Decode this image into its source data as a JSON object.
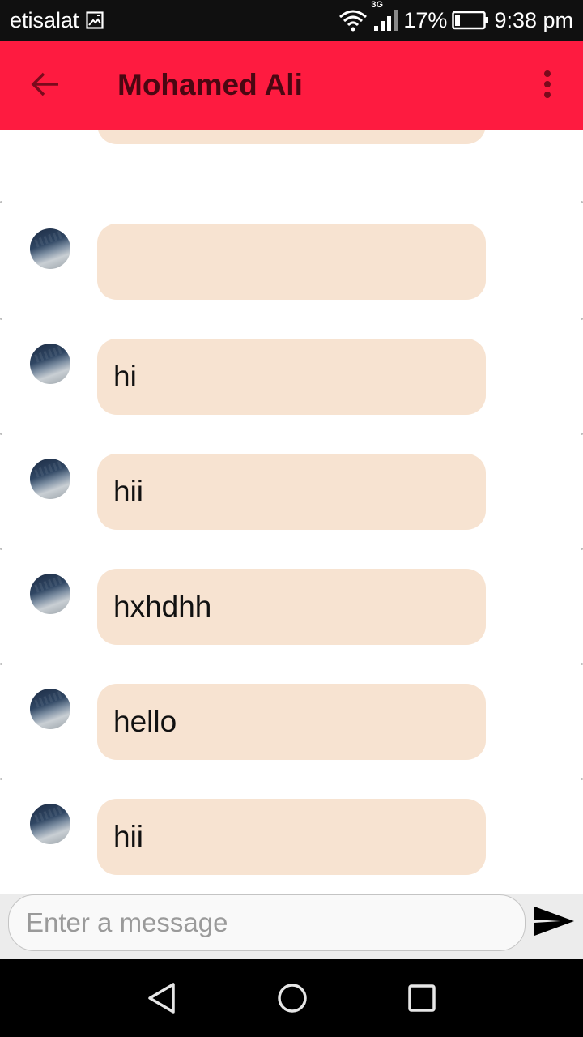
{
  "status_bar": {
    "carrier": "etisalat",
    "network_type": "3G",
    "battery_percent": "17%",
    "battery_level": 0.17,
    "time": "9:38 pm",
    "icons": [
      "gallery-icon",
      "wifi-icon",
      "signal-icon",
      "battery-icon"
    ]
  },
  "app_bar": {
    "title": "Mohamed Ali",
    "back_icon": "arrow-back-icon",
    "menu_icon": "more-vert-icon"
  },
  "messages": [
    {
      "text": ""
    },
    {
      "text": ""
    },
    {
      "text": "hi"
    },
    {
      "text": "hii"
    },
    {
      "text": "hxhdhh"
    },
    {
      "text": "hello"
    },
    {
      "text": "hii"
    }
  ],
  "composer": {
    "placeholder": "Enter a message",
    "value": "",
    "send_icon": "send-icon"
  },
  "nav_bar": {
    "icons": [
      "back-triangle-icon",
      "home-circle-icon",
      "recents-square-icon"
    ]
  },
  "colors": {
    "app_bar": "#fe1b40",
    "title_text": "#4a0712",
    "bubble": "#f7e3d1",
    "status_bar": "#101010",
    "composer_bg": "#ececec"
  }
}
